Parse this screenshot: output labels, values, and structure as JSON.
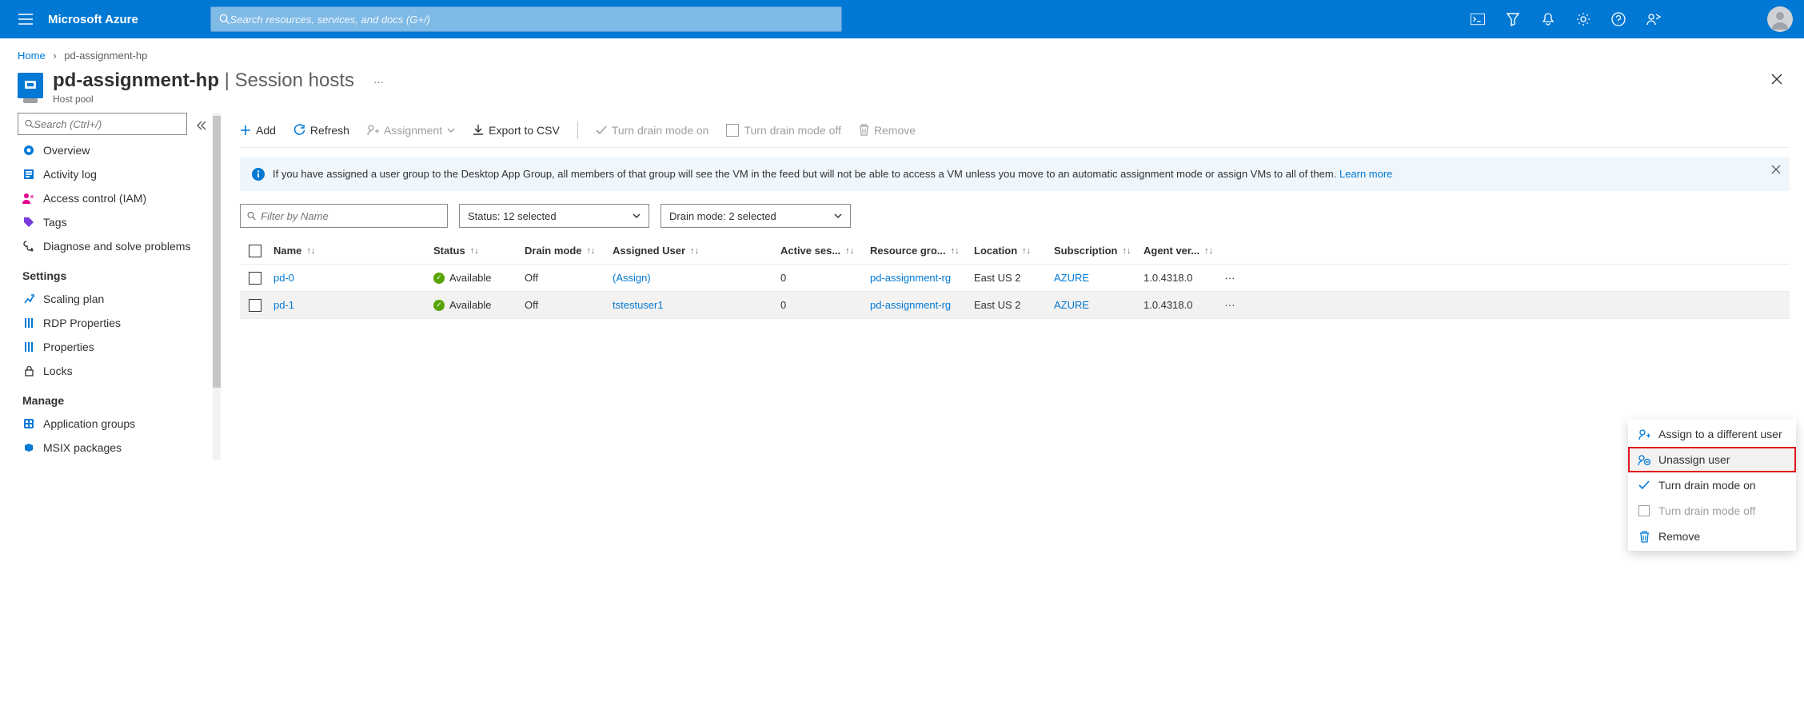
{
  "brand": "Microsoft Azure",
  "search": {
    "placeholder": "Search resources, services, and docs (G+/)"
  },
  "breadcrumb": {
    "home": "Home",
    "resource": "pd-assignment-hp"
  },
  "page": {
    "title_main": "pd-assignment-hp",
    "title_section": "Session hosts",
    "subtitle": "Host pool"
  },
  "sidebar": {
    "search_placeholder": "Search (Ctrl+/)",
    "items": [
      {
        "label": "Overview"
      },
      {
        "label": "Activity log"
      },
      {
        "label": "Access control (IAM)"
      },
      {
        "label": "Tags"
      },
      {
        "label": "Diagnose and solve problems"
      }
    ],
    "section_settings": "Settings",
    "settings_items": [
      {
        "label": "Scaling plan"
      },
      {
        "label": "RDP Properties"
      },
      {
        "label": "Properties"
      },
      {
        "label": "Locks"
      }
    ],
    "section_manage": "Manage",
    "manage_items": [
      {
        "label": "Application groups"
      },
      {
        "label": "MSIX packages"
      }
    ]
  },
  "toolbar": {
    "add": "Add",
    "refresh": "Refresh",
    "assignment": "Assignment",
    "export": "Export to CSV",
    "drain_on": "Turn drain mode on",
    "drain_off": "Turn drain mode off",
    "remove": "Remove"
  },
  "banner": {
    "text": "If you have assigned a user group to the Desktop App Group, all members of that group will see the VM in the feed but will not be able to access a VM unless you move to an automatic assignment mode or assign VMs to all of them. ",
    "link": "Learn more"
  },
  "filters": {
    "name_placeholder": "Filter by Name",
    "status": "Status: 12 selected",
    "drain": "Drain mode: 2 selected"
  },
  "columns": {
    "name": "Name",
    "status": "Status",
    "drain": "Drain mode",
    "user": "Assigned User",
    "active": "Active ses...",
    "rg": "Resource gro...",
    "loc": "Location",
    "sub": "Subscription",
    "agent": "Agent ver..."
  },
  "rows": [
    {
      "name": "pd-0",
      "status": "Available",
      "drain": "Off",
      "user": "(Assign)",
      "active": "0",
      "rg": "pd-assignment-rg",
      "loc": "East US 2",
      "sub": "AZURE",
      "agent": "1.0.4318.0"
    },
    {
      "name": "pd-1",
      "status": "Available",
      "drain": "Off",
      "user": "tstestuser1",
      "active": "0",
      "rg": "pd-assignment-rg",
      "loc": "East US 2",
      "sub": "AZURE",
      "agent": "1.0.4318.0"
    }
  ],
  "context_menu": {
    "assign_other": "Assign to a different user",
    "unassign": "Unassign user",
    "drain_on": "Turn drain mode on",
    "drain_off": "Turn drain mode off",
    "remove": "Remove"
  }
}
